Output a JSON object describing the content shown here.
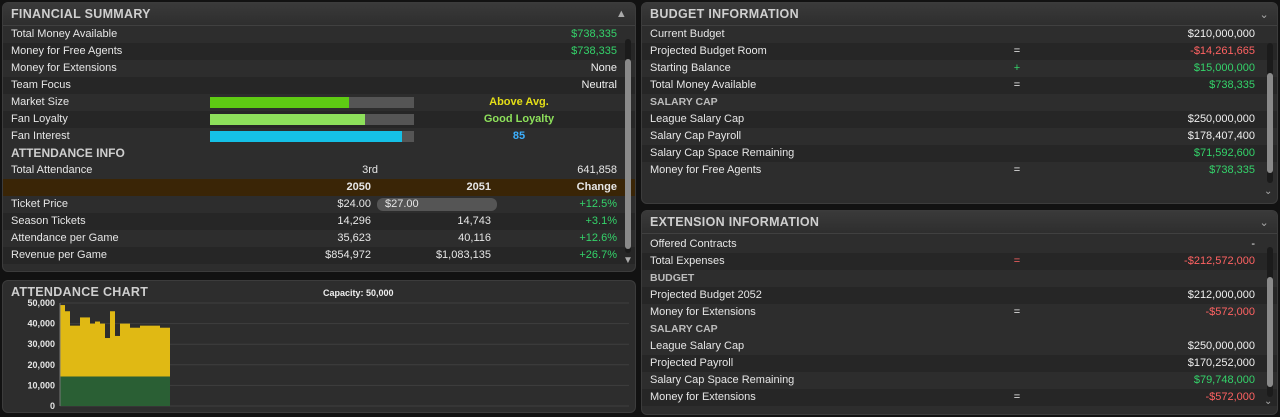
{
  "financial": {
    "title": "FINANCIAL SUMMARY",
    "rows": [
      {
        "label": "Total Money Available",
        "value": "$738,335"
      },
      {
        "label": "Money for Free Agents",
        "value": "$738,335"
      },
      {
        "label": "Money for Extensions",
        "value": "None"
      },
      {
        "label": "Team Focus",
        "value": "Neutral"
      }
    ],
    "bars": [
      {
        "label": "Market Size",
        "level": 0.68,
        "text": "Above Avg.",
        "color": "#5ecb13",
        "textColor": "#e5df17"
      },
      {
        "label": "Fan Loyalty",
        "level": 0.76,
        "text": "Good Loyalty",
        "color": "#8de05b",
        "textColor": "#8de05b"
      },
      {
        "label": "Fan Interest",
        "level": 0.94,
        "text": "85",
        "color": "#15c0e6",
        "textColor": "#3cb0ff"
      }
    ]
  },
  "attendance": {
    "title": "ATTENDANCE INFO",
    "total": {
      "label": "Total Attendance",
      "rank": "3rd",
      "value": "641,858"
    },
    "headers": [
      "2050",
      "2051",
      "Change"
    ],
    "ticket": {
      "label": "Ticket Price",
      "y2050": "$24.00",
      "y2051": "$27.00",
      "change": "+12.5%"
    },
    "rows": [
      {
        "label": "Season Tickets",
        "y2050": "14,296",
        "y2051": "14,743",
        "change": "+3.1%"
      },
      {
        "label": "Attendance per Game",
        "y2050": "35,623",
        "y2051": "40,116",
        "change": "+12.6%"
      },
      {
        "label": "Revenue per Game",
        "y2050": "$854,972",
        "y2051": "$1,083,135",
        "change": "+26.7%"
      }
    ]
  },
  "chart_panel": {
    "title": "ATTENDANCE CHART",
    "capacity": "Capacity: 50,000"
  },
  "chart_data": {
    "type": "bar",
    "ylim": [
      0,
      50000
    ],
    "yticks": [
      "50,000",
      "40,000",
      "30,000",
      "20,000",
      "10,000",
      "0"
    ],
    "season_tickets": 14296,
    "values": [
      49000,
      46000,
      39000,
      39000,
      43000,
      43000,
      40000,
      41000,
      40000,
      33000,
      46000,
      34000,
      40000,
      40000,
      38000,
      38000,
      39000,
      39000,
      39000,
      39000,
      38000,
      38000
    ],
    "colors": {
      "season": "#2a5f34",
      "single": "#e0b914"
    }
  },
  "budget": {
    "title": "BUDGET INFORMATION",
    "rows": [
      {
        "label": "Current Budget",
        "op": "",
        "value": "$210,000,000",
        "cls": "white"
      },
      {
        "label": "Projected Budget Room",
        "op": "=",
        "value": "-$14,261,665",
        "cls": "red"
      },
      {
        "label": "Starting Balance",
        "op": "+",
        "value": "$15,000,000",
        "cls": "green",
        "opCls": "green"
      },
      {
        "label": "Total Money Available",
        "op": "=",
        "value": "$738,335",
        "cls": "green"
      }
    ],
    "salary_cap_label": "SALARY CAP",
    "cap_rows": [
      {
        "label": "League Salary Cap",
        "op": "",
        "value": "$250,000,000",
        "cls": "white"
      },
      {
        "label": "Salary Cap Payroll",
        "op": "",
        "value": "$178,407,400",
        "cls": "white"
      },
      {
        "label": "Salary Cap Space Remaining",
        "op": "",
        "value": "$71,592,600",
        "cls": "green"
      },
      {
        "label": "Money for Free Agents",
        "op": "=",
        "value": "$738,335",
        "cls": "green"
      }
    ]
  },
  "extension": {
    "title": "EXTENSION INFORMATION",
    "rows": [
      {
        "label": "Offered Contracts",
        "op": "",
        "value": "-",
        "cls": "white"
      },
      {
        "label": "Total Expenses",
        "op": "=",
        "value": "-$212,572,000",
        "cls": "red",
        "opCls": "red"
      }
    ],
    "budget_label": "BUDGET",
    "budget_rows": [
      {
        "label": "Projected Budget 2052",
        "op": "",
        "value": "$212,000,000",
        "cls": "white"
      },
      {
        "label": "Money for Extensions",
        "op": "=",
        "value": "-$572,000",
        "cls": "red"
      }
    ],
    "salary_cap_label": "SALARY CAP",
    "cap_rows": [
      {
        "label": "League Salary Cap",
        "op": "",
        "value": "$250,000,000",
        "cls": "white"
      },
      {
        "label": "Projected Payroll",
        "op": "",
        "value": "$170,252,000",
        "cls": "white"
      },
      {
        "label": "Salary Cap Space Remaining",
        "op": "",
        "value": "$79,748,000",
        "cls": "green"
      },
      {
        "label": "Money for Extensions",
        "op": "=",
        "value": "-$572,000",
        "cls": "red"
      }
    ]
  },
  "icons": {
    "collapse": "chevron-down-icon",
    "up": "chevron-up-icon"
  }
}
